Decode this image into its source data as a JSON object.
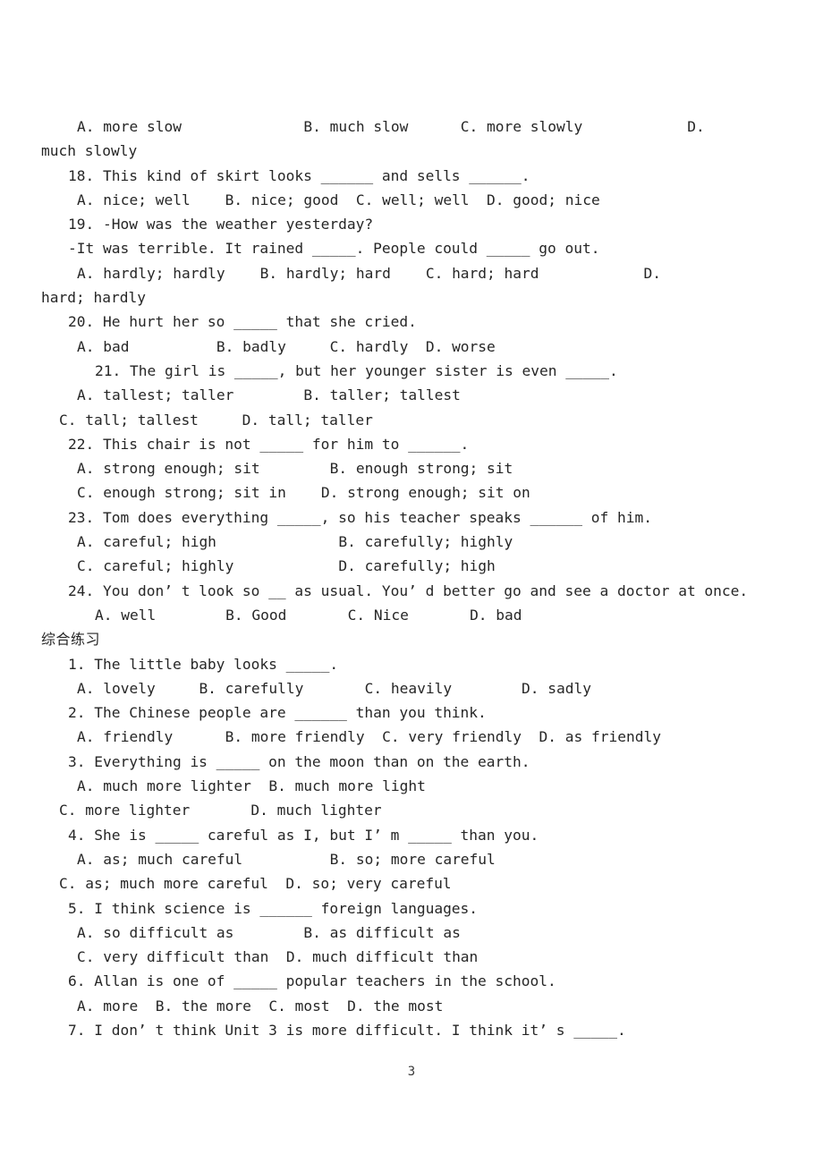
{
  "document": {
    "page_number": "3",
    "section_heading_cn": "综合练习",
    "lines": [
      {
        "indent": 3,
        "text": "A. more slow              B. much slow      C. more slowly            D."
      },
      {
        "indent": 0,
        "text": "much slowly"
      },
      {
        "indent": 2,
        "text": "18. This kind of skirt looks ______ and sells ______."
      },
      {
        "indent": 3,
        "text": "A. nice; well    B. nice; good  C. well; well  D. good; nice"
      },
      {
        "indent": 2,
        "text": "19. -How was the weather yesterday?"
      },
      {
        "indent": 2,
        "text": "-It was terrible. It rained _____. People could _____ go out."
      },
      {
        "indent": 3,
        "text": "A. hardly; hardly    B. hardly; hard    C. hard; hard            D."
      },
      {
        "indent": 0,
        "text": "hard; hardly"
      },
      {
        "indent": 2,
        "text": "20. He hurt her so _____ that she cried."
      },
      {
        "indent": 3,
        "text": "A. bad          B. badly     C. hardly  D. worse"
      },
      {
        "indent": 4,
        "text": "21. The girl is _____, but her younger sister is even _____."
      },
      {
        "indent": 3,
        "text": "A. tallest; taller        B. taller; tallest"
      },
      {
        "indent": 1,
        "text": "C. tall; tallest     D. tall; taller"
      },
      {
        "indent": 2,
        "text": "22. This chair is not _____ for him to ______."
      },
      {
        "indent": 3,
        "text": "A. strong enough; sit        B. enough strong; sit"
      },
      {
        "indent": 3,
        "text": "C. enough strong; sit in    D. strong enough; sit on"
      },
      {
        "indent": 2,
        "text": "23. Tom does everything _____, so his teacher speaks ______ of him."
      },
      {
        "indent": 3,
        "text": "A. careful; high              B. carefully; highly"
      },
      {
        "indent": 3,
        "text": "C. careful; highly            D. carefully; high"
      },
      {
        "indent": 2,
        "text": "24. You don’ t look so __ as usual. You’ d better go and see a doctor at once."
      },
      {
        "indent": 4,
        "text": "A. well        B. Good       C. Nice       D. bad"
      },
      {
        "indent": 2,
        "text": "1. The little baby looks _____."
      },
      {
        "indent": 3,
        "text": "A. lovely     B. carefully       C. heavily        D. sadly"
      },
      {
        "indent": 2,
        "text": "2. The Chinese people are ______ than you think."
      },
      {
        "indent": 3,
        "text": "A. friendly      B. more friendly  C. very friendly  D. as friendly"
      },
      {
        "indent": 2,
        "text": "3. Everything is _____ on the moon than on the earth."
      },
      {
        "indent": 3,
        "text": "A. much more lighter  B. much more light"
      },
      {
        "indent": 1,
        "text": "C. more lighter       D. much lighter"
      },
      {
        "indent": 2,
        "text": "4. She is _____ careful as I, but I’ m _____ than you."
      },
      {
        "indent": 3,
        "text": "A. as; much careful          B. so; more careful"
      },
      {
        "indent": 1,
        "text": "C. as; much more careful  D. so; very careful"
      },
      {
        "indent": 2,
        "text": "5. I think science is ______ foreign languages."
      },
      {
        "indent": 3,
        "text": "A. so difficult as        B. as difficult as"
      },
      {
        "indent": 3,
        "text": "C. very difficult than  D. much difficult than"
      },
      {
        "indent": 2,
        "text": "6. Allan is one of _____ popular teachers in the school."
      },
      {
        "indent": 3,
        "text": "A. more  B. the more  C. most  D. the most"
      },
      {
        "indent": 2,
        "text": "7. I don’ t think Unit 3 is more difficult. I think it’ s _____."
      }
    ],
    "heading_after_line_index": 20
  }
}
